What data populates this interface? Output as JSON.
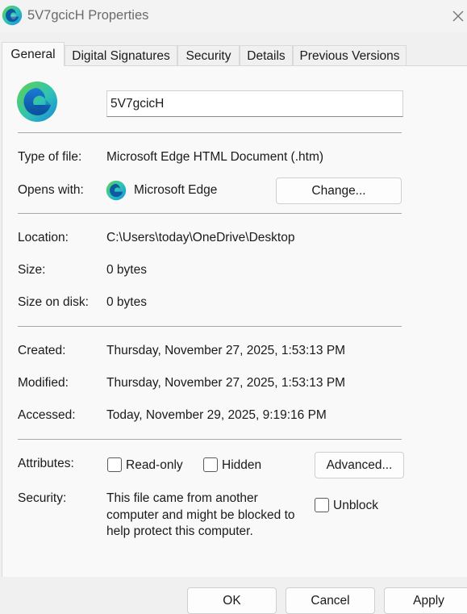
{
  "window": {
    "title": "5V7gcicH Properties"
  },
  "tabs": [
    {
      "label": "General"
    },
    {
      "label": "Digital Signatures"
    },
    {
      "label": "Security"
    },
    {
      "label": "Details"
    },
    {
      "label": "Previous Versions"
    }
  ],
  "general": {
    "file_name": "5V7gcicH",
    "type_label": "Type of file:",
    "type_value": "Microsoft Edge HTML Document (.htm)",
    "opens_label": "Opens with:",
    "opens_value": "Microsoft Edge",
    "change_label": "Change...",
    "location_label": "Location:",
    "location_value": "C:\\Users\\today\\OneDrive\\Desktop",
    "size_label": "Size:",
    "size_value": "0 bytes",
    "size_on_disk_label": "Size on disk:",
    "size_on_disk_value": "0 bytes",
    "created_label": "Created:",
    "created_value": "Thursday, November 27, 2025, 1:53:13 PM",
    "modified_label": "Modified:",
    "modified_value": "Thursday, November 27, 2025, 1:53:13 PM",
    "accessed_label": "Accessed:",
    "accessed_value": "Today, November 29, 2025, 9:19:16 PM",
    "attributes_label": "Attributes:",
    "readonly_label": "Read-only",
    "readonly_checked": false,
    "hidden_label": "Hidden",
    "hidden_checked": false,
    "advanced_label": "Advanced...",
    "security_label": "Security:",
    "security_text": "This file came from another computer and might be blocked to help protect this computer.",
    "unblock_label": "Unblock",
    "unblock_checked": false
  },
  "footer": {
    "ok_label": "OK",
    "cancel_label": "Cancel",
    "apply_label": "Apply"
  },
  "colors": {
    "edge_blue": "#0c59a4",
    "edge_teal": "#2fc3b3",
    "edge_green": "#5fd34d",
    "panel_bg": "#f9f9f9"
  }
}
